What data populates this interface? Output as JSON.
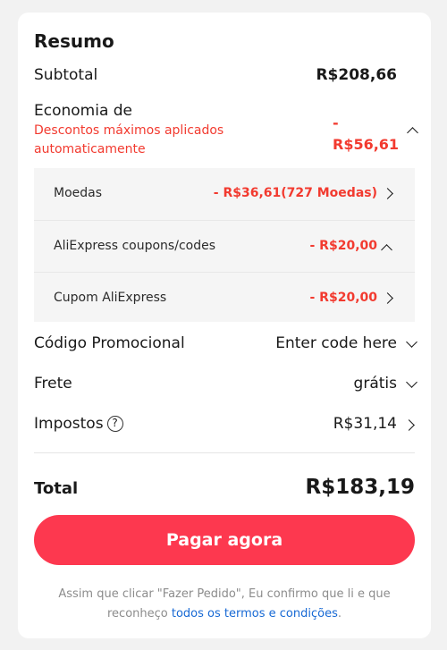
{
  "summary": {
    "title": "Resumo",
    "subtotal_label": "Subtotal",
    "subtotal_value": "R$208,66",
    "savings_label": "Economia de",
    "savings_note_line1": "Descontos máximos aplicados",
    "savings_note_line2": "automaticamente",
    "savings_value_line1": "-",
    "savings_value_line2": "R$56,61",
    "breakdown": [
      {
        "label": "Moedas",
        "value": "- R$36,61(727 Moedas)"
      },
      {
        "label": "AliExpress coupons/codes",
        "value": "- R$20,00"
      },
      {
        "label": "Cupom AliExpress",
        "value": "- R$20,00"
      }
    ],
    "promo_label": "Código Promocional",
    "promo_value": "Enter code here",
    "shipping_label": "Frete",
    "shipping_value": "grátis",
    "taxes_label": "Impostos",
    "taxes_help": "?",
    "taxes_value": "R$31,14",
    "total_label": "Total",
    "total_value": "R$183,19",
    "pay_button": "Pagar agora",
    "terms_line1": "Assim que clicar \"Fazer Pedido\", Eu confirmo que li e que",
    "terms_line2_prefix": "reconheço ",
    "terms_link": "todos os termos e condições",
    "terms_line2_suffix": "."
  },
  "colors": {
    "accent": "#fd384f",
    "discount": "#f23a2f",
    "link": "#1769d4"
  }
}
